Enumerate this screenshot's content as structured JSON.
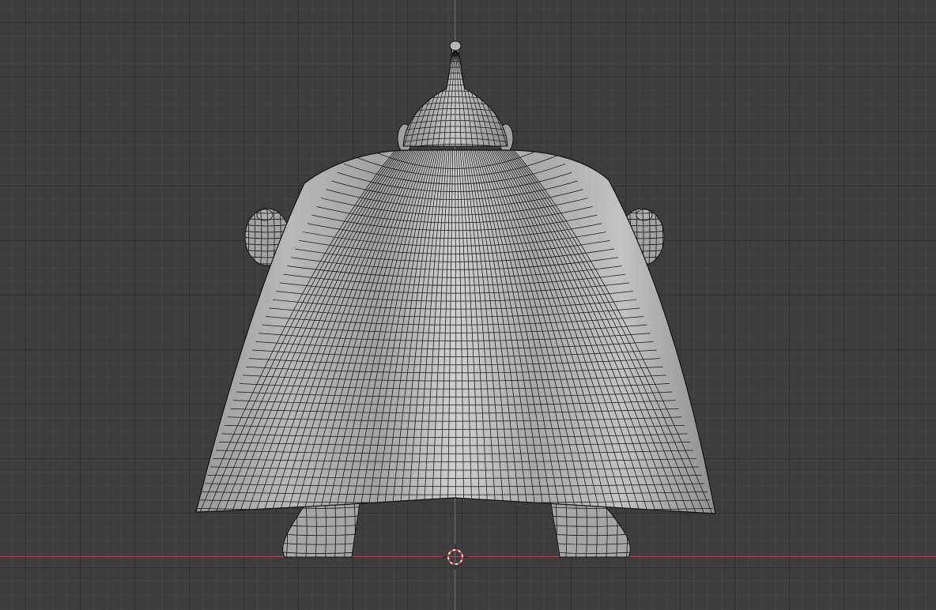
{
  "viewport": {
    "mode": "object-view",
    "object": "cloaked-character-mesh",
    "display": "solid-with-wireframe"
  },
  "colors": {
    "background": "#3d3d3d",
    "grid_major": "#2d2d2d",
    "axis_x": "#b5455a",
    "axis_z": "#4a79c8",
    "mesh_base": "#a9a9a9",
    "mesh_highlight": "#d0d0d0",
    "wire": "#151515",
    "cursor_red": "#e23b3b"
  },
  "icons": {
    "cursor": "3d-cursor-icon"
  }
}
